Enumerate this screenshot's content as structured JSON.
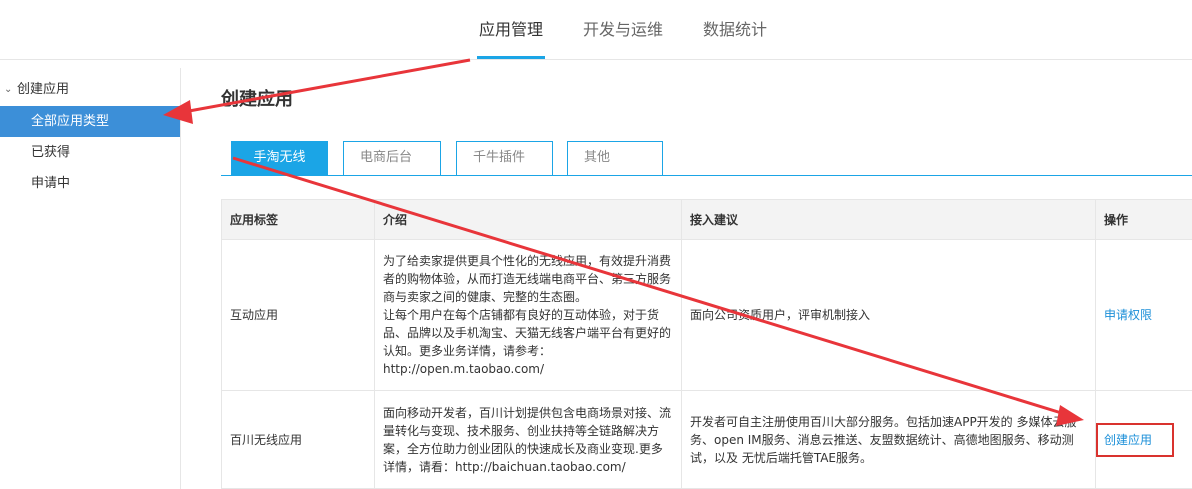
{
  "topnav": {
    "tabs": [
      {
        "label": "应用管理",
        "active": true
      },
      {
        "label": "开发与运维",
        "active": false
      },
      {
        "label": "数据统计",
        "active": false
      }
    ]
  },
  "sidebar": {
    "group_label": "创建应用",
    "items": [
      {
        "label": "全部应用类型",
        "active": true
      },
      {
        "label": "已获得",
        "active": false
      },
      {
        "label": "申请中",
        "active": false
      }
    ]
  },
  "main": {
    "title": "创建应用",
    "tabs": [
      {
        "label": "手淘无线",
        "active": true
      },
      {
        "label": "电商后台",
        "active": false
      },
      {
        "label": "千牛插件",
        "active": false
      },
      {
        "label": "其他",
        "active": false
      }
    ],
    "table": {
      "headers": [
        "应用标签",
        "介绍",
        "接入建议",
        "操作"
      ],
      "rows": [
        {
          "tag": "互动应用",
          "intro_p1": "为了给卖家提供更具个性化的无线应用，有效提升消费者的购物体验，从而打造无线端电商平台、第三方服务商与卖家之间的健康、完整的生态圈。",
          "intro_p2": "让每个用户在每个店铺都有良好的互动体验，对于货品、品牌以及手机淘宝、天猫无线客户端平台有更好的认知。更多业务详情，请参考：",
          "intro_p3": "http://open.m.taobao.com/",
          "advice": "面向公司资质用户，评审机制接入",
          "action": "申请权限"
        },
        {
          "tag": "百川无线应用",
          "intro_p1": "面向移动开发者，百川计划提供包含电商场景对接、流量转化与变现、技术服务、创业扶持等全链路解决方案，全方位助力创业团队的快速成长及商业变现.更多详情，请看：http://baichuan.taobao.com/",
          "advice": "开发者可自主注册使用百川大部分服务。包括加速APP开发的 多媒体云服务、open IM服务、消息云推送、友盟数据统计、高德地图服务、移动测试，以及 无忧后端托管TAE服务。",
          "action": "创建应用"
        }
      ]
    }
  },
  "colors": {
    "accent": "#1ba5e6",
    "sidebar_active": "#3c8fd8",
    "annotation_red": "#e8353a",
    "link": "#1b8fd8"
  }
}
